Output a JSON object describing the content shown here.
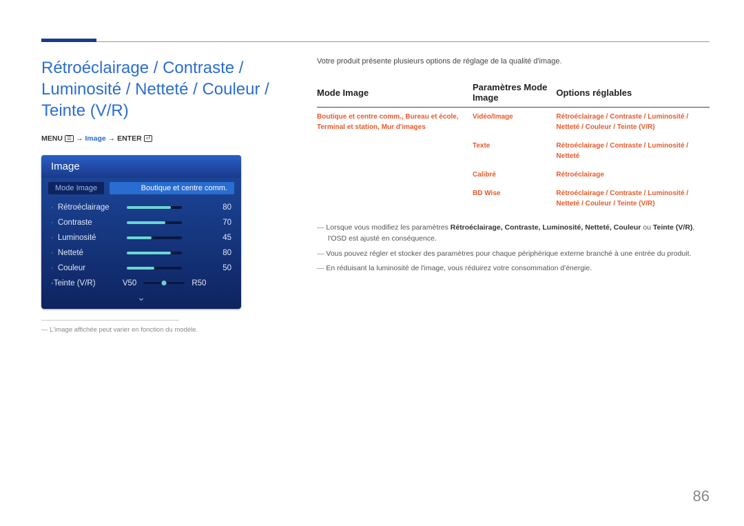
{
  "page_number": "86",
  "header": {
    "title": "Rétroéclairage / Contraste / Luminosité / Netteté / Couleur / Teinte (V/R)"
  },
  "breadcrumb": {
    "menu_label": "MENU",
    "menu_icon": "☰",
    "arrow": "→",
    "image_label": "Image",
    "enter_label": "ENTER",
    "enter_icon": "⏎"
  },
  "osd": {
    "title": "Image",
    "mode_label": "Mode Image",
    "mode_value": "Boutique et centre comm.",
    "rows": [
      {
        "name": "Rétroéclairage",
        "value": 80
      },
      {
        "name": "Contraste",
        "value": 70
      },
      {
        "name": "Luminosité",
        "value": 45
      },
      {
        "name": "Netteté",
        "value": 80
      },
      {
        "name": "Couleur",
        "value": 50
      }
    ],
    "tint": {
      "name": "Teinte (V/R)",
      "left": "V50",
      "right": "R50"
    },
    "chevron": "⌄"
  },
  "footnote": "L'image affichée peut varier en fonction du modèle.",
  "right": {
    "intro": "Votre produit présente plusieurs options de réglage de la qualité d'image.",
    "headers": [
      "Mode Image",
      "Paramètres Mode Image",
      "Options réglables"
    ],
    "rows": [
      {
        "c1": "Boutique et centre comm., Bureau et école, Terminal et station, Mur d'images",
        "c2": "Vidéo/Image",
        "c3": "Rétroéclairage / Contraste / Luminosité / Netteté / Couleur / Teinte (V/R)"
      },
      {
        "c1": "",
        "c2": "Texte",
        "c3": "Rétroéclairage / Contraste / Luminosité / Netteté"
      },
      {
        "c1": "",
        "c2": "Calibré",
        "c3": "Rétroéclairage"
      },
      {
        "c1": "",
        "c2": "BD Wise",
        "c3": "Rétroéclairage / Contraste / Luminosité / Netteté / Couleur / Teinte (V/R)"
      }
    ],
    "notes": {
      "n1_prefix": "Lorsque vous modifiez les paramètres ",
      "n1_bold_list": "Rétroéclairage, Contraste, Luminosité, Netteté, Couleur",
      "n1_or": " ou ",
      "n1_bold_last": "Teinte (V/R)",
      "n1_suffix": ", l'OSD est ajusté en conséquence.",
      "n2": "Vous pouvez régler et stocker des paramètres pour chaque périphérique externe branché à une entrée du produit.",
      "n3": "En réduisant la luminosité de l'image, vous réduirez votre consommation d'énergie."
    }
  }
}
